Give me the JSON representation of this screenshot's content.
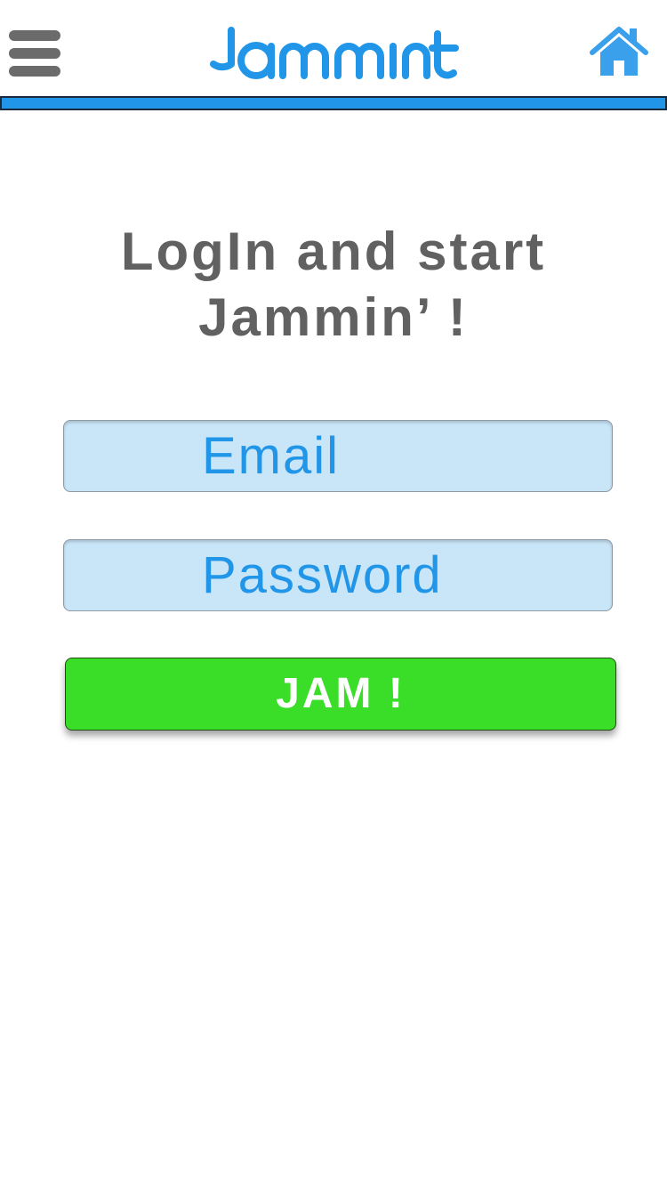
{
  "header": {
    "logo_text": "Jammint",
    "menu_icon": "hamburger-menu-icon",
    "home_icon": "home-icon"
  },
  "main": {
    "title_line1": "LogIn and start",
    "title_line2": "Jammin’ !",
    "email_placeholder": "Email",
    "password_placeholder": "Password",
    "submit_label": "JAM !"
  },
  "colors": {
    "accent_blue": "#2196e8",
    "icon_blue": "#3aa0ec",
    "menu_gray": "#6b6b6b",
    "title_gray": "#616161",
    "field_bg": "#c9e5f8",
    "button_green": "#3ade28"
  }
}
